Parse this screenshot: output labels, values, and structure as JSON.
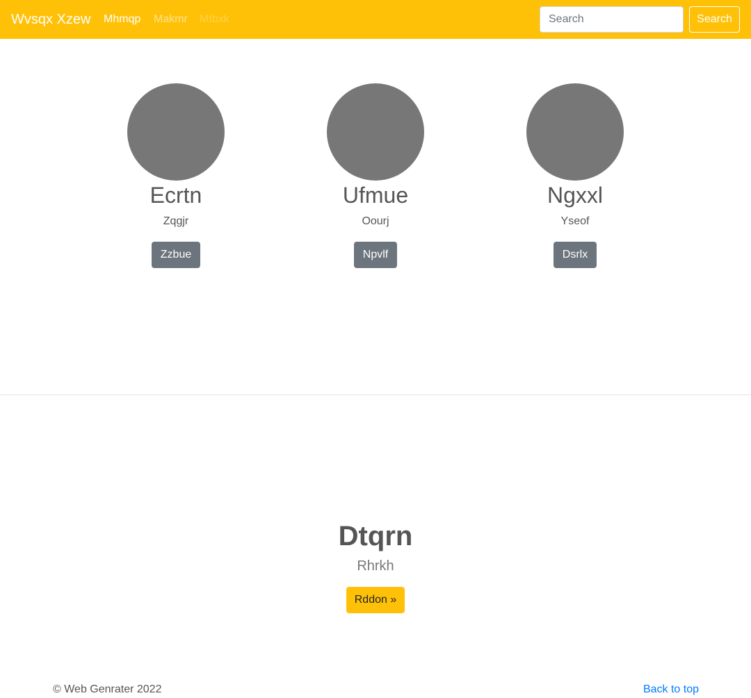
{
  "navbar": {
    "brand": "Wvsqx Xzew",
    "links": [
      {
        "label": "Mhmqp",
        "state": "active"
      },
      {
        "label": "Makmr",
        "state": "normal"
      },
      {
        "label": "Mtbxk",
        "state": "disabled"
      }
    ],
    "search": {
      "placeholder": "Search",
      "value": ""
    },
    "search_button": "Search",
    "background_color": "#ffc107"
  },
  "team": [
    {
      "name": "Ecrtn",
      "role": "Zqgjr",
      "button": "Zzbue"
    },
    {
      "name": "Ufmue",
      "role": "Oourj",
      "button": "Npvlf"
    },
    {
      "name": "Ngxxl",
      "role": "Yseof",
      "button": "Dsrlx"
    }
  ],
  "hero": {
    "title": "Dtqrn",
    "subtitle": "Rhrkh",
    "button": "Rddon »"
  },
  "footer": {
    "copyright": "© Web Genrater 2022",
    "back_to_top": "Back to top"
  },
  "colors": {
    "accent": "#ffc107",
    "secondary_button": "#6c757d",
    "avatar_placeholder": "#777777",
    "link": "#007bff"
  }
}
